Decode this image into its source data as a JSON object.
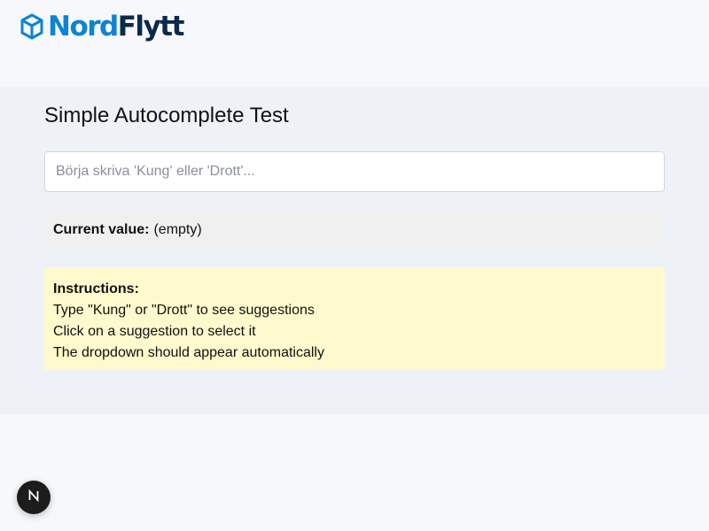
{
  "brand": {
    "name_part1": "Nord",
    "name_part2": "Flytt",
    "primary_color": "#0e83d4",
    "dark_color": "#0b2a4a",
    "icon": "box-icon"
  },
  "page": {
    "title": "Simple Autocomplete Test"
  },
  "search": {
    "value": "",
    "placeholder": "Börja skriva 'Kung' eller 'Drott'..."
  },
  "current_value": {
    "label": "Current value:",
    "value": "(empty)"
  },
  "instructions": {
    "title": "Instructions:",
    "lines": [
      "Type \"Kung\" or \"Drott\" to see suggestions",
      "Click on a suggestion to select it",
      "The dropdown should appear automatically"
    ]
  },
  "dev_badge": {
    "icon": "nextjs-icon",
    "letter": "N"
  }
}
